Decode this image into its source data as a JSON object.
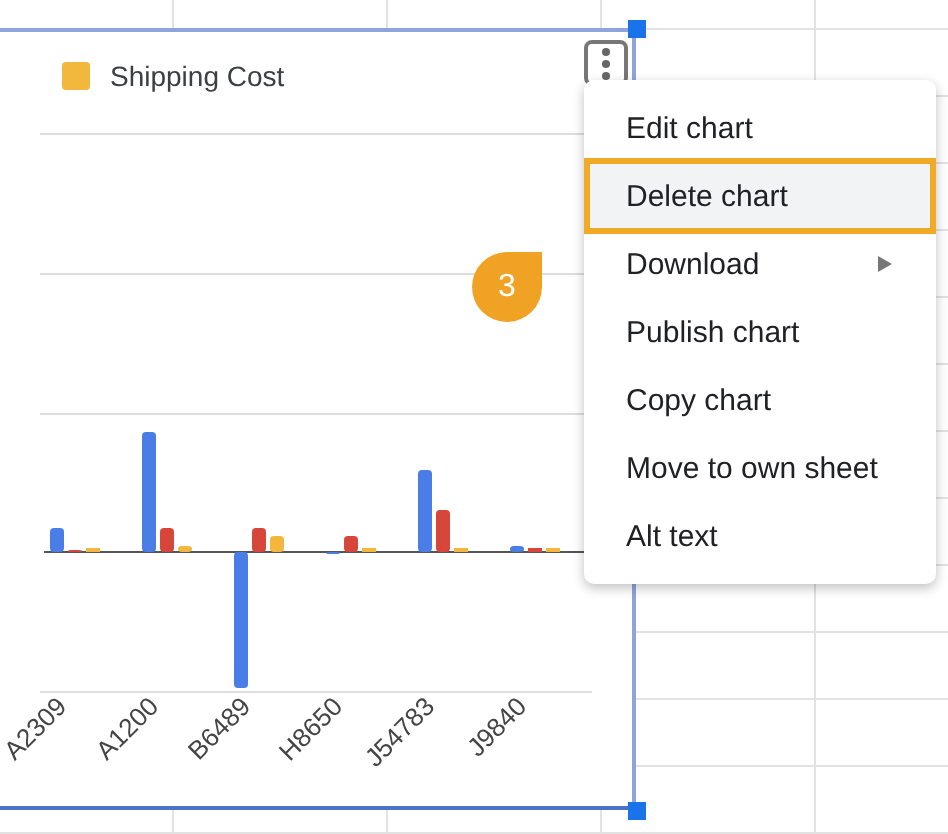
{
  "chart": {
    "legend": [
      {
        "label": "Shipping Cost",
        "color": "#f4b73d"
      }
    ],
    "x_labels": [
      "A2309",
      "A1200",
      "B6489",
      "H8650",
      "J54783",
      "J9840"
    ]
  },
  "menu": {
    "items": [
      {
        "label": "Edit chart",
        "selected": false,
        "kind": "action"
      },
      {
        "label": "Delete chart",
        "selected": true,
        "kind": "action"
      },
      {
        "label": "Download",
        "selected": false,
        "kind": "submenu"
      },
      {
        "label": "Publish chart",
        "selected": false,
        "kind": "action"
      },
      {
        "label": "Copy chart",
        "selected": false,
        "kind": "action"
      },
      {
        "label": "Move to own sheet",
        "selected": false,
        "kind": "action"
      },
      {
        "label": "Alt text",
        "selected": false,
        "kind": "action"
      }
    ]
  },
  "callout": {
    "label": "3"
  }
}
